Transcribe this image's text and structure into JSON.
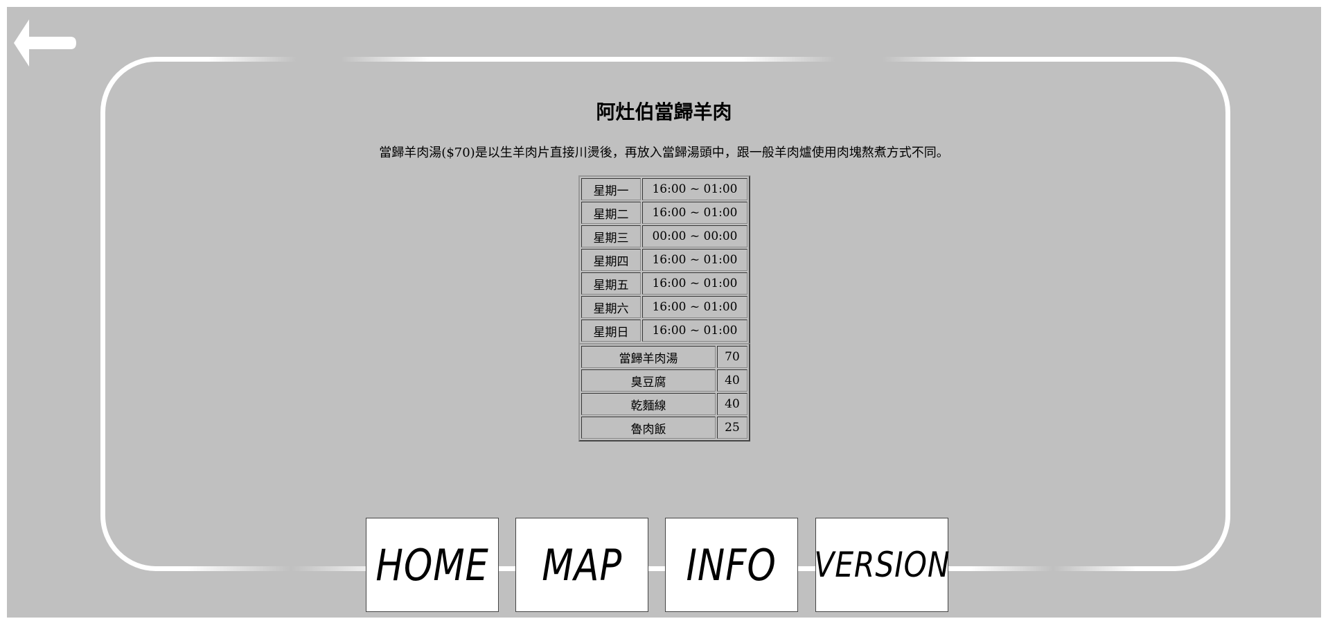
{
  "page": {
    "title": "阿灶伯當歸羊肉",
    "description": "當歸羊肉湯($70)是以生羊肉片直接川燙後，再放入當歸湯頭中，跟一般羊肉爐使用肉塊熬煮方式不同。"
  },
  "hours": [
    {
      "day": "星期一",
      "time": "16:00 ~ 01:00"
    },
    {
      "day": "星期二",
      "time": "16:00 ~ 01:00"
    },
    {
      "day": "星期三",
      "time": "00:00 ~ 00:00"
    },
    {
      "day": "星期四",
      "time": "16:00 ~ 01:00"
    },
    {
      "day": "星期五",
      "time": "16:00 ~ 01:00"
    },
    {
      "day": "星期六",
      "time": "16:00 ~ 01:00"
    },
    {
      "day": "星期日",
      "time": "16:00 ~ 01:00"
    }
  ],
  "menu": [
    {
      "item": "當歸羊肉湯",
      "price": "70"
    },
    {
      "item": "臭豆腐",
      "price": "40"
    },
    {
      "item": "乾麵線",
      "price": "40"
    },
    {
      "item": "魯肉飯",
      "price": "25"
    }
  ],
  "nav": {
    "home": "HOME",
    "map": "MAP",
    "info": "INFO",
    "version": "VERSION"
  },
  "icons": {
    "back": "back-arrow-icon"
  },
  "colors": {
    "background": "#c0c0c0",
    "frame": "#ffffff"
  }
}
